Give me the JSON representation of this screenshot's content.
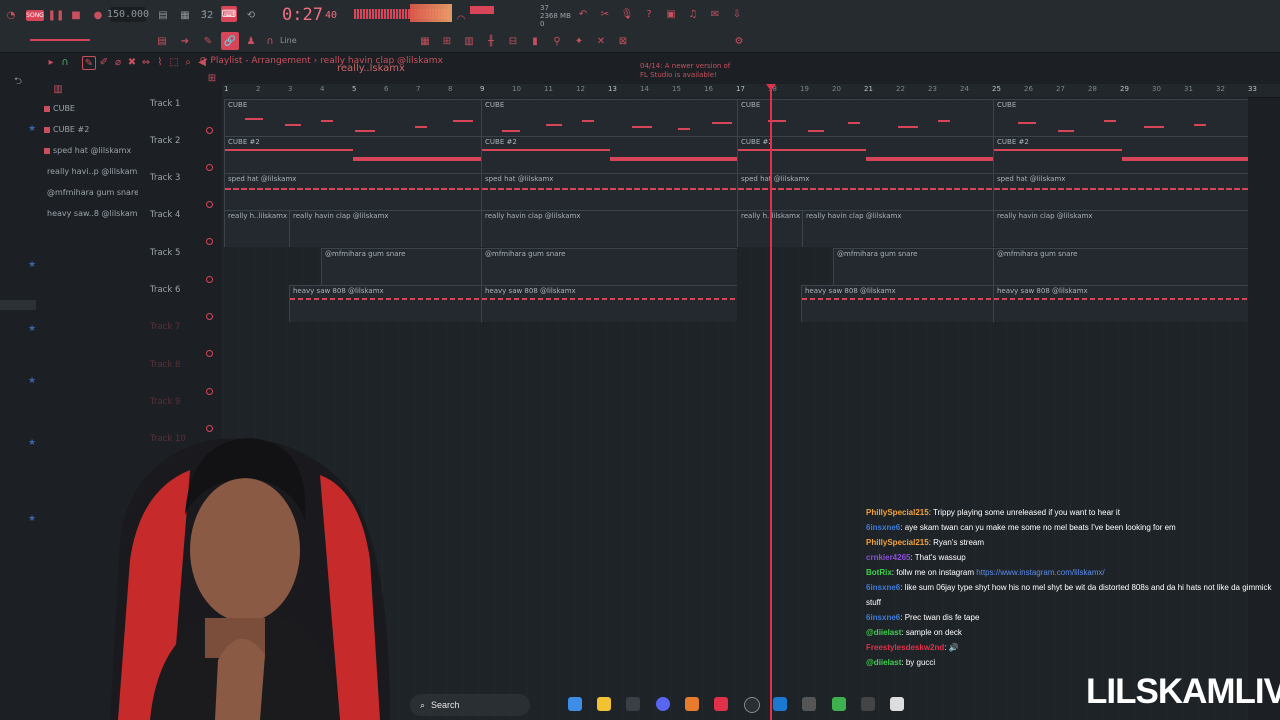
{
  "toolbar": {
    "song_badge": "SONG",
    "tempo": "150.000",
    "clock": "0:27",
    "clock_frac": "40",
    "cpu_line1": "37",
    "cpu_line2": "2368 MB",
    "cpu_line3": "0",
    "notice_line1": "04/14: A newer version of",
    "notice_line2": "FL Studio is available!",
    "pattern_name": "really..lskamx",
    "mode_label": "Line"
  },
  "breadcrumb": {
    "prefix": "Playlist - Arrangement",
    "sep": "›",
    "current": "really havin clap @lilskamx"
  },
  "browser": {
    "items": [
      {
        "label": "CUBE"
      },
      {
        "label": "CUBE #2"
      },
      {
        "label": "sped hat @lilskamx"
      },
      {
        "label": "really havi..p @lilskamx"
      },
      {
        "label": "@mfmihara gum snare"
      },
      {
        "label": "heavy saw..8 @lilskamx"
      }
    ]
  },
  "ruler": [
    "1",
    "2",
    "3",
    "4",
    "5",
    "6",
    "7",
    "8",
    "9",
    "10",
    "11",
    "12",
    "13",
    "14",
    "15",
    "16",
    "17",
    "18",
    "19",
    "20",
    "21",
    "22",
    "23",
    "24",
    "25",
    "26",
    "27",
    "28",
    "29",
    "30",
    "31",
    "32",
    "33"
  ],
  "tracks": [
    {
      "name": "Track 1"
    },
    {
      "name": "Track 2"
    },
    {
      "name": "Track 3"
    },
    {
      "name": "Track 4"
    },
    {
      "name": "Track 5"
    },
    {
      "name": "Track 6"
    },
    {
      "name": "Track 7"
    },
    {
      "name": "Track 8"
    },
    {
      "name": "Track 9"
    },
    {
      "name": "Track 10"
    }
  ],
  "clips": {
    "cube": "CUBE",
    "cube2": "CUBE #2",
    "sped": "sped hat @lilskamx",
    "really_short": "really h..lilskamx",
    "really": "really havin clap @lilskamx",
    "snare": "@mfmihara gum snare",
    "saw": "heavy saw 808 @lilskamx"
  },
  "chat": [
    {
      "user": "PhillySpecial215",
      "color": "#f2a43a",
      "text": ": Trippy playing some unreleased if you want to hear it"
    },
    {
      "user": "6insxne6",
      "color": "#3d7bd8",
      "text": ": aye skam twan can yu make me some no mel beats I've been looking for em"
    },
    {
      "user": "PhillySpecial215",
      "color": "#f2a43a",
      "text": ": Ryan's stream"
    },
    {
      "user": "crnkier4265",
      "color": "#8a4fd8",
      "text": ": That's wassup"
    },
    {
      "user": "BotRix",
      "color": "#3fd24e",
      "text": ": follw me on instagram ",
      "link": "https://www.instagram.com/lilskamx/"
    },
    {
      "user": "6insxne6",
      "color": "#3d7bd8",
      "text": ": like sum 06jay type shyt how his no mel shyt be wit da distorted 808s and da hi hats not like da gimmick"
    },
    {
      "user": "",
      "color": "#ffffff",
      "text": "stuff"
    },
    {
      "user": "6insxne6",
      "color": "#3d7bd8",
      "text": ": Prec twan dis fe tape"
    },
    {
      "user": "@diielast",
      "color": "#3fd24e",
      "text": ": sample on deck"
    },
    {
      "user": "Freestylesdeskw2nd",
      "color": "#e0304a",
      "text": ": 🔊"
    },
    {
      "user": "@diielast",
      "color": "#3fd24e",
      "text": ": by gucci"
    }
  ],
  "taskbar": {
    "search_label": "Search"
  },
  "brand": "LILSKAMLIVE",
  "colors": {
    "accent": "#d84558",
    "playhead": "#e0304a",
    "background": "#1c2024"
  }
}
